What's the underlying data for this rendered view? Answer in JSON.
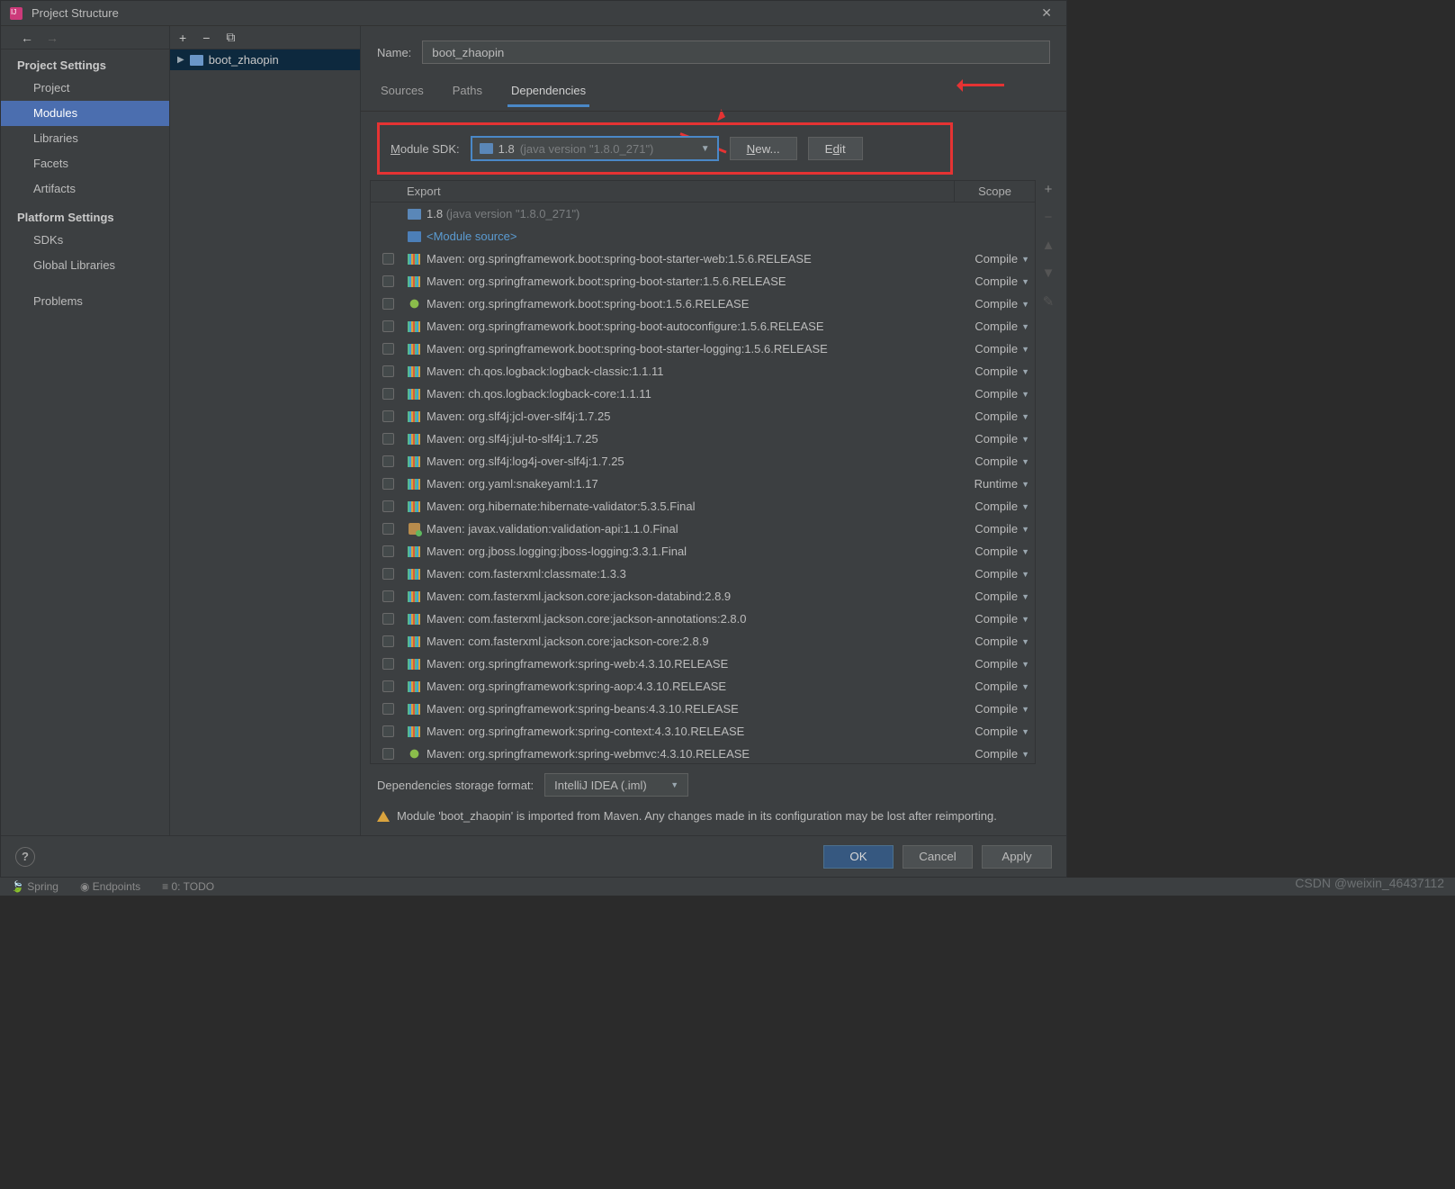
{
  "window": {
    "title": "Project Structure"
  },
  "leftnav": {
    "back_tip": "Back",
    "fwd_tip": "Forward",
    "project_settings_header": "Project Settings",
    "platform_settings_header": "Platform Settings",
    "items_project": "Project",
    "items_modules": "Modules",
    "items_libraries": "Libraries",
    "items_facets": "Facets",
    "items_artifacts": "Artifacts",
    "items_sdks": "SDKs",
    "items_global": "Global Libraries",
    "items_problems": "Problems"
  },
  "middle": {
    "add_tip": "+",
    "remove_tip": "−",
    "copy_tip": "⧉",
    "module_name": "boot_zhaopin"
  },
  "main": {
    "name_label": "Name:",
    "name_value": "boot_zhaopin",
    "tabs": {
      "sources": "Sources",
      "paths": "Paths",
      "dependencies": "Dependencies"
    },
    "module_sdk_label": "Module SDK:",
    "sdk_main": "1.8",
    "sdk_detail": "(java version \"1.8.0_271\")",
    "new_btn": "New...",
    "edit_btn": "Edit",
    "table_head_export": "Export",
    "table_head_scope": "Scope",
    "rows": [
      {
        "icon": "jdk",
        "name_main": "1.8 ",
        "name_dim": "(java version \"1.8.0_271\")",
        "scope": "",
        "check": false,
        "link": false
      },
      {
        "icon": "mod",
        "name_main": "<Module source>",
        "name_dim": "",
        "scope": "",
        "check": false,
        "link": true
      },
      {
        "icon": "lib",
        "name_main": "Maven: org.springframework.boot:spring-boot-starter-web:1.5.6.RELEASE",
        "name_dim": "",
        "scope": "Compile",
        "check": true,
        "link": false
      },
      {
        "icon": "lib",
        "name_main": "Maven: org.springframework.boot:spring-boot-starter:1.5.6.RELEASE",
        "name_dim": "",
        "scope": "Compile",
        "check": true,
        "link": false
      },
      {
        "icon": "leaf",
        "name_main": "Maven: org.springframework.boot:spring-boot:1.5.6.RELEASE",
        "name_dim": "",
        "scope": "Compile",
        "check": true,
        "link": false
      },
      {
        "icon": "lib",
        "name_main": "Maven: org.springframework.boot:spring-boot-autoconfigure:1.5.6.RELEASE",
        "name_dim": "",
        "scope": "Compile",
        "check": true,
        "link": false
      },
      {
        "icon": "lib",
        "name_main": "Maven: org.springframework.boot:spring-boot-starter-logging:1.5.6.RELEASE",
        "name_dim": "",
        "scope": "Compile",
        "check": true,
        "link": false
      },
      {
        "icon": "lib",
        "name_main": "Maven: ch.qos.logback:logback-classic:1.1.11",
        "name_dim": "",
        "scope": "Compile",
        "check": true,
        "link": false
      },
      {
        "icon": "lib",
        "name_main": "Maven: ch.qos.logback:logback-core:1.1.11",
        "name_dim": "",
        "scope": "Compile",
        "check": true,
        "link": false
      },
      {
        "icon": "lib",
        "name_main": "Maven: org.slf4j:jcl-over-slf4j:1.7.25",
        "name_dim": "",
        "scope": "Compile",
        "check": true,
        "link": false
      },
      {
        "icon": "lib",
        "name_main": "Maven: org.slf4j:jul-to-slf4j:1.7.25",
        "name_dim": "",
        "scope": "Compile",
        "check": true,
        "link": false
      },
      {
        "icon": "lib",
        "name_main": "Maven: org.slf4j:log4j-over-slf4j:1.7.25",
        "name_dim": "",
        "scope": "Compile",
        "check": true,
        "link": false
      },
      {
        "icon": "lib",
        "name_main": "Maven: org.yaml:snakeyaml:1.17",
        "name_dim": "",
        "scope": "Runtime",
        "check": true,
        "link": false
      },
      {
        "icon": "lib",
        "name_main": "Maven: org.hibernate:hibernate-validator:5.3.5.Final",
        "name_dim": "",
        "scope": "Compile",
        "check": true,
        "link": false
      },
      {
        "icon": "box",
        "name_main": "Maven: javax.validation:validation-api:1.1.0.Final",
        "name_dim": "",
        "scope": "Compile",
        "check": true,
        "link": false
      },
      {
        "icon": "lib",
        "name_main": "Maven: org.jboss.logging:jboss-logging:3.3.1.Final",
        "name_dim": "",
        "scope": "Compile",
        "check": true,
        "link": false
      },
      {
        "icon": "lib",
        "name_main": "Maven: com.fasterxml:classmate:1.3.3",
        "name_dim": "",
        "scope": "Compile",
        "check": true,
        "link": false
      },
      {
        "icon": "lib",
        "name_main": "Maven: com.fasterxml.jackson.core:jackson-databind:2.8.9",
        "name_dim": "",
        "scope": "Compile",
        "check": true,
        "link": false
      },
      {
        "icon": "lib",
        "name_main": "Maven: com.fasterxml.jackson.core:jackson-annotations:2.8.0",
        "name_dim": "",
        "scope": "Compile",
        "check": true,
        "link": false
      },
      {
        "icon": "lib",
        "name_main": "Maven: com.fasterxml.jackson.core:jackson-core:2.8.9",
        "name_dim": "",
        "scope": "Compile",
        "check": true,
        "link": false
      },
      {
        "icon": "lib",
        "name_main": "Maven: org.springframework:spring-web:4.3.10.RELEASE",
        "name_dim": "",
        "scope": "Compile",
        "check": true,
        "link": false
      },
      {
        "icon": "lib",
        "name_main": "Maven: org.springframework:spring-aop:4.3.10.RELEASE",
        "name_dim": "",
        "scope": "Compile",
        "check": true,
        "link": false
      },
      {
        "icon": "lib",
        "name_main": "Maven: org.springframework:spring-beans:4.3.10.RELEASE",
        "name_dim": "",
        "scope": "Compile",
        "check": true,
        "link": false
      },
      {
        "icon": "lib",
        "name_main": "Maven: org.springframework:spring-context:4.3.10.RELEASE",
        "name_dim": "",
        "scope": "Compile",
        "check": true,
        "link": false
      },
      {
        "icon": "leaf",
        "name_main": "Maven: org.springframework:spring-webmvc:4.3.10.RELEASE",
        "name_dim": "",
        "scope": "Compile",
        "check": true,
        "link": false
      }
    ],
    "side_tools": {
      "add": "+",
      "remove": "−",
      "up": "▲",
      "down": "▼",
      "edit": "✎"
    },
    "storage_label": "Dependencies storage format:",
    "storage_value": "IntelliJ IDEA (.iml)",
    "warning": "Module 'boot_zhaopin' is imported from Maven. Any changes made in its configuration may be lost after reimporting."
  },
  "buttons": {
    "ok": "OK",
    "cancel": "Cancel",
    "apply": "Apply"
  },
  "ide_status": {
    "spring": "Spring",
    "endpoints": "Endpoints",
    "todo": "0: TODO"
  },
  "watermark": "CSDN @weixin_46437112"
}
